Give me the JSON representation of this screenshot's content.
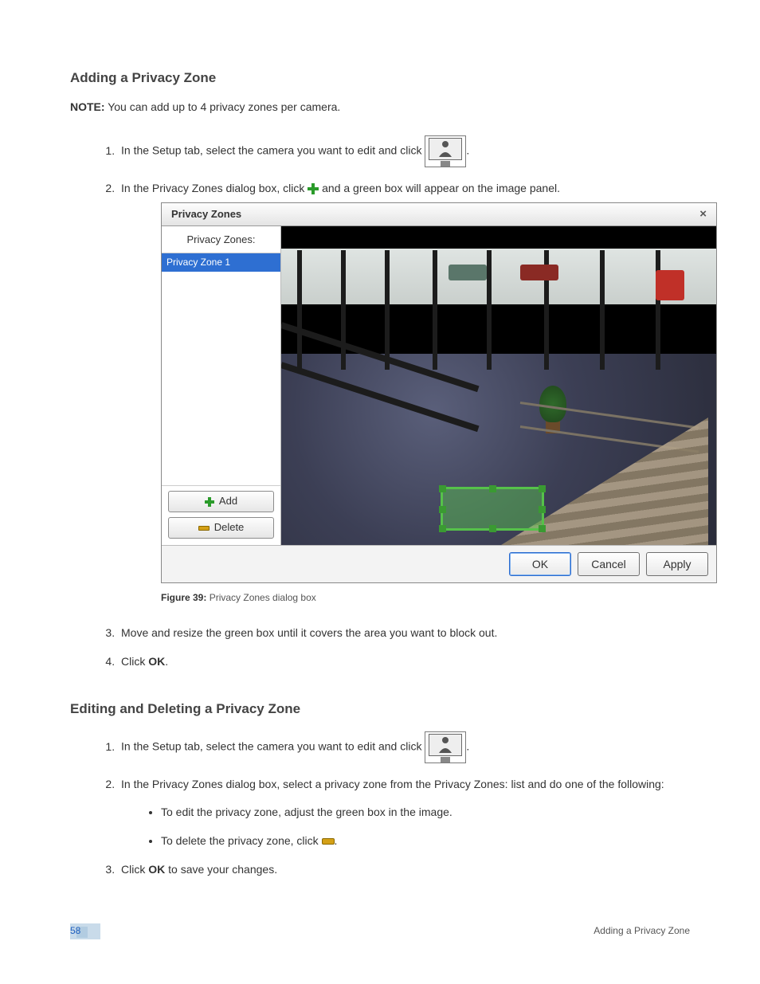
{
  "section1": {
    "title": "Adding a Privacy Zone",
    "note_label": "NOTE:",
    "note_text": " You can add up to 4 privacy zones per camera.",
    "steps": {
      "s1a": "In the Setup tab, select the camera you want to edit and click ",
      "s1b": ".",
      "s2a": "In the Privacy Zones dialog box, click ",
      "s2b": " and a green box will appear on the image panel.",
      "s3": "Move and resize the green box until it covers the area you want to block out.",
      "s4a": "Click ",
      "s4b": "OK",
      "s4c": "."
    }
  },
  "dialog": {
    "title": "Privacy Zones",
    "list_header": "Privacy Zones:",
    "items": [
      "Privacy Zone 1"
    ],
    "add_label": "Add",
    "delete_label": "Delete",
    "ok": "OK",
    "cancel": "Cancel",
    "apply": "Apply"
  },
  "figure": {
    "label": "Figure 39:",
    "caption": " Privacy Zones dialog box"
  },
  "section2": {
    "title": "Editing and Deleting a Privacy Zone",
    "steps": {
      "s1a": "In the Setup tab, select the camera you want to edit and click ",
      "s1b": ".",
      "s2": "In the Privacy Zones dialog box, select a privacy zone from the Privacy Zones: list and do one of the following:",
      "bul1": "To edit the privacy zone, adjust the green box in the image.",
      "bul2a": "To delete the privacy zone, click ",
      "bul2b": ".",
      "s3a": "Click ",
      "s3b": "OK",
      "s3c": " to save your changes."
    }
  },
  "footer": {
    "page": "58",
    "label": "Adding a Privacy Zone"
  }
}
